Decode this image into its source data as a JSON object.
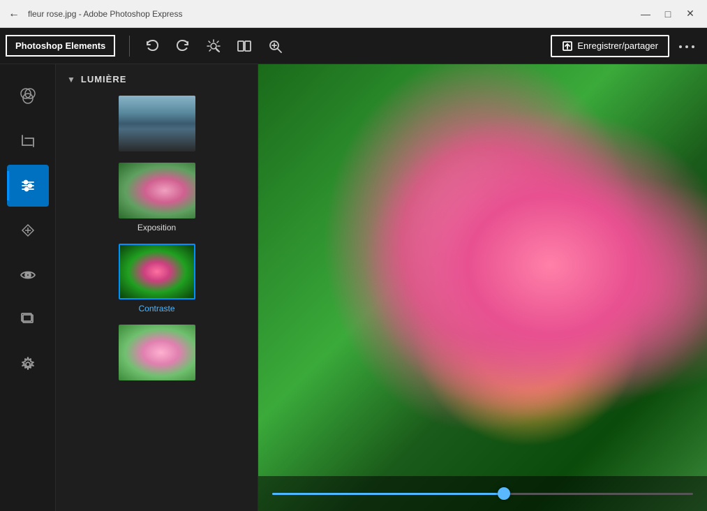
{
  "titleBar": {
    "title": "fleur rose.jpg - Adobe Photoshop Express",
    "backLabel": "←",
    "minimizeLabel": "—",
    "maximizeLabel": "□",
    "closeLabel": "✕"
  },
  "toolbar": {
    "appName": "Photoshop Elements",
    "undoLabel": "↩",
    "redoLabel": "↪",
    "magicLabel": "✦",
    "compareLabel": "⊟",
    "zoomLabel": "⊕",
    "saveLabel": "Enregistrer/partager",
    "moreLabel": "···"
  },
  "sidebar": {
    "icons": [
      {
        "name": "color-wheel",
        "symbol": "◎",
        "active": false
      },
      {
        "name": "crop",
        "symbol": "⊡",
        "active": false
      },
      {
        "name": "adjustments",
        "symbol": "⊜",
        "active": true
      },
      {
        "name": "healing",
        "symbol": "⬡",
        "active": false
      },
      {
        "name": "eye",
        "symbol": "◉",
        "active": false
      },
      {
        "name": "layers",
        "symbol": "⬜",
        "active": false
      },
      {
        "name": "settings",
        "symbol": "⚙",
        "active": false
      }
    ]
  },
  "panel": {
    "sectionTitle": "LUMIÈRE",
    "items": [
      {
        "label": "",
        "type": "building",
        "selected": false
      },
      {
        "label": "Exposition",
        "type": "flower-normal",
        "selected": false
      },
      {
        "label": "Contraste",
        "type": "flower-contrast",
        "selected": true
      },
      {
        "label": "",
        "type": "flower-light",
        "selected": false
      }
    ]
  },
  "canvas": {
    "sliderValue": 55
  }
}
